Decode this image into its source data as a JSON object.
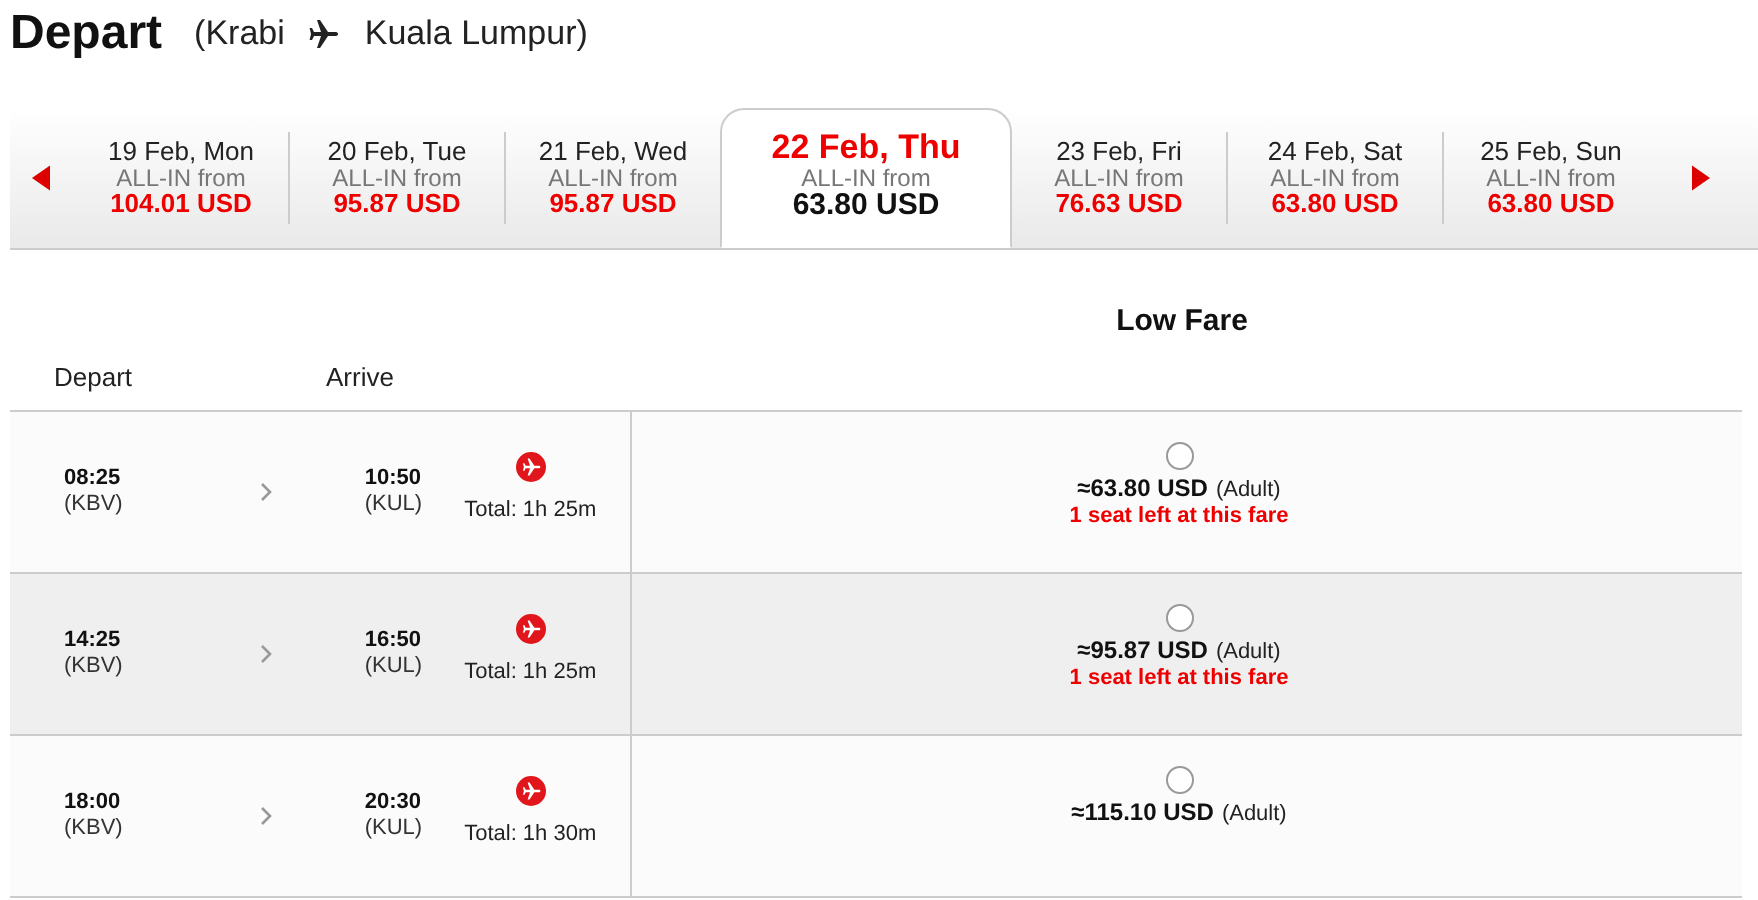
{
  "header": {
    "title": "Depart",
    "origin": "(Krabi",
    "destination": "Kuala Lumpur)"
  },
  "dates": [
    {
      "date": "19 Feb, Mon",
      "label": "ALL-IN from",
      "price": "104.01 USD",
      "selected": false
    },
    {
      "date": "20 Feb, Tue",
      "label": "ALL-IN from",
      "price": "95.87 USD",
      "selected": false
    },
    {
      "date": "21 Feb, Wed",
      "label": "ALL-IN from",
      "price": "95.87 USD",
      "selected": false
    },
    {
      "date": "22 Feb, Thu",
      "label": "ALL-IN from",
      "price": "63.80 USD",
      "selected": true
    },
    {
      "date": "23 Feb, Fri",
      "label": "ALL-IN from",
      "price": "76.63 USD",
      "selected": false
    },
    {
      "date": "24 Feb, Sat",
      "label": "ALL-IN from",
      "price": "63.80 USD",
      "selected": false
    },
    {
      "date": "25 Feb, Sun",
      "label": "ALL-IN from",
      "price": "63.80 USD",
      "selected": false
    }
  ],
  "fare_heading": "Low Fare",
  "columns": [
    "Depart",
    "Arrive"
  ],
  "flights": [
    {
      "depart": "08:25",
      "from": "(KBV)",
      "arrive": "10:50",
      "to": "(KUL)",
      "total": "Total: 1h 25m",
      "price": "≈63.80 USD",
      "pax": "(Adult)",
      "note": "1 seat left at this fare",
      "selected": false
    },
    {
      "depart": "14:25",
      "from": "(KBV)",
      "arrive": "16:50",
      "to": "(KUL)",
      "total": "Total: 1h 25m",
      "price": "≈95.87 USD",
      "pax": "(Adult)",
      "note": "1 seat left at this fare",
      "selected": false
    },
    {
      "depart": "18:00",
      "from": "(KBV)",
      "arrive": "20:30",
      "to": "(KUL)",
      "total": "Total: 1h 30m",
      "price": "≈115.10 USD",
      "pax": "(Adult)",
      "selected": false
    }
  ]
}
